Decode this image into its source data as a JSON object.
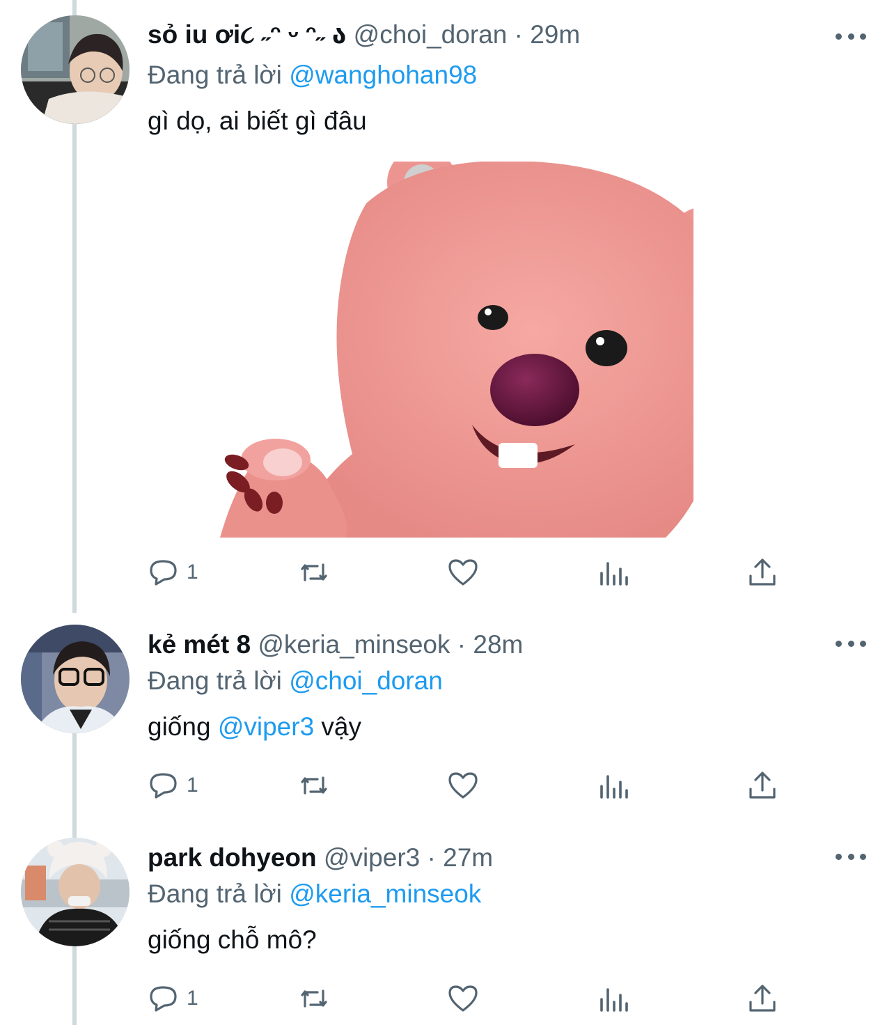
{
  "colors": {
    "link": "#1d9bf0",
    "muted": "#536471",
    "text": "#0f1419",
    "thread_line": "#cfd9de"
  },
  "tweets": [
    {
      "name": "sỏ iu ơi૮ ˶ᵔ ᵕ ᵔ˶ ა",
      "handle": "@choi_doran",
      "sep": "·",
      "time": "29m",
      "reply_label": "Đang trả lời",
      "reply_to": "@wanghohan98",
      "text": "gì dọ, ai biết gì đâu",
      "reply_count": "1",
      "has_media": true
    },
    {
      "name": "kẻ mét 8",
      "handle": "@keria_minseok",
      "sep": "·",
      "time": "28m",
      "reply_label": "Đang trả lời",
      "reply_to": "@choi_doran",
      "text_before": "giống ",
      "text_mention": "@viper3",
      "text_after": " vậy",
      "reply_count": "1"
    },
    {
      "name": "park dohyeon",
      "handle": "@viper3",
      "sep": "·",
      "time": "27m",
      "reply_label": "Đang trả lời",
      "reply_to": "@keria_minseok",
      "text": "giống chỗ mô?",
      "reply_count": "1"
    }
  ],
  "icons": [
    "reply-icon",
    "retweet-icon",
    "like-icon",
    "views-icon",
    "share-icon",
    "more-icon"
  ]
}
